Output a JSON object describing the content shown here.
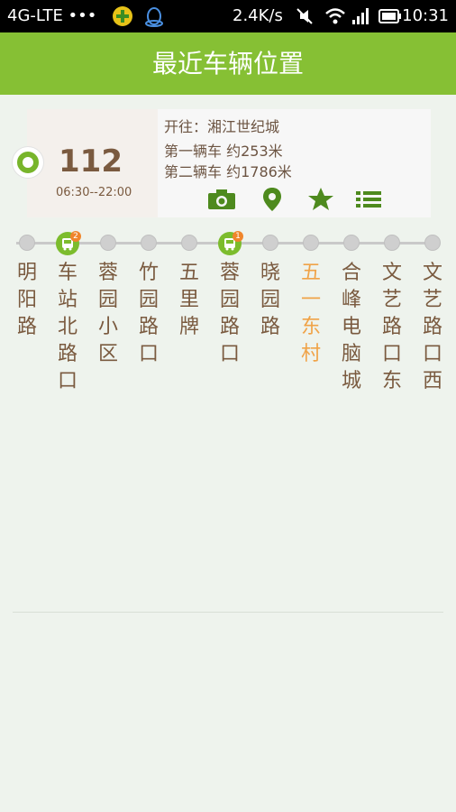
{
  "status_bar": {
    "network": "4G-LTE •••",
    "speed": "2.4K/s",
    "time": "10:31",
    "icons": [
      "app-plus-icon",
      "qq-penguin-icon",
      "mute-icon",
      "wifi-icon",
      "signal-icon",
      "battery-icon"
    ]
  },
  "header": {
    "title": "最近车辆位置"
  },
  "route": {
    "number": "112",
    "hours": "06:30--22:00",
    "direction": "开往：湘江世纪城",
    "first_bus": "第一辆车  约253米",
    "second_bus": "第二辆车  约1786米",
    "actions": [
      "camera-icon",
      "location-pin-icon",
      "star-icon",
      "list-icon"
    ]
  },
  "stops": [
    {
      "name": "明阳路",
      "kind": "partial"
    },
    {
      "name": "车站北路口",
      "bus_count": "2"
    },
    {
      "name": "蓉园小区"
    },
    {
      "name": "竹园路口"
    },
    {
      "name": "五里牌"
    },
    {
      "name": "蓉园路口",
      "bus_count": "1"
    },
    {
      "name": "晓园路"
    },
    {
      "name": "五一东村",
      "current": true
    },
    {
      "name": "合峰电脑城"
    },
    {
      "name": "文艺路口东"
    },
    {
      "name": "文艺路口西"
    }
  ],
  "colors": {
    "header_green": "#86c034",
    "stop_text_brown": "#7a5a3f",
    "current_stop_orange": "#f0a348",
    "badge_orange": "#f0852b"
  }
}
